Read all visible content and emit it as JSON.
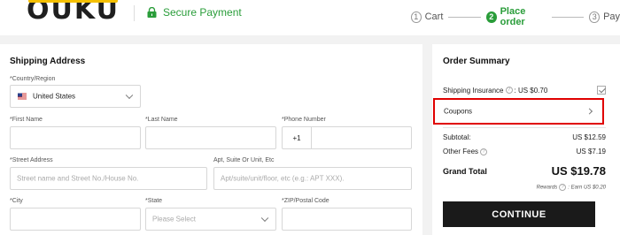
{
  "header": {
    "logo_text": "OUKU",
    "secure_label": "Secure Payment",
    "steps": [
      {
        "num": "1",
        "label": "Cart"
      },
      {
        "num": "2",
        "label": "Place order"
      },
      {
        "num": "3",
        "label": "Pay"
      }
    ],
    "active_step": 2,
    "accent_color": "#2a9d3a",
    "logo_accent_color": "#f5c000"
  },
  "shipping": {
    "title": "Shipping Address",
    "country": {
      "label": "*Country/Region",
      "value": "United States",
      "flag_icon": "us-flag-icon"
    },
    "first_name": {
      "label": "*First Name",
      "value": "",
      "placeholder": ""
    },
    "last_name": {
      "label": "*Last Name",
      "value": "",
      "placeholder": ""
    },
    "phone": {
      "label": "*Phone Number",
      "prefix": "+1",
      "value": ""
    },
    "street": {
      "label": "*Street Address",
      "placeholder": "Street name and Street No./House No."
    },
    "apt": {
      "label": "Apt, Suite Or Unit, Etc",
      "placeholder": "Apt/suite/unit/floor, etc (e.g.: APT XXX)."
    },
    "city": {
      "label": "*City",
      "value": ""
    },
    "state": {
      "label": "*State",
      "placeholder": "Please Select"
    },
    "zip": {
      "label": "*ZIP/Postal Code",
      "value": ""
    }
  },
  "summary": {
    "title": "Order Summary",
    "shipping_insurance_label": "Shipping Insurance",
    "shipping_insurance_value": ": US $0.70",
    "shipping_insurance_checked": true,
    "coupons_label": "Coupons",
    "subtotal_label": "Subtotal:",
    "subtotal_value": "US $12.59",
    "other_fees_label": "Other Fees",
    "other_fees_value": "US $7.19",
    "grand_total_label": "Grand Total",
    "grand_total_value": "US $19.78",
    "rewards_label": "Rewards",
    "rewards_value": ": Earn US $0.20",
    "continue_label": "CONTINUE",
    "highlight_color": "#e00000"
  }
}
